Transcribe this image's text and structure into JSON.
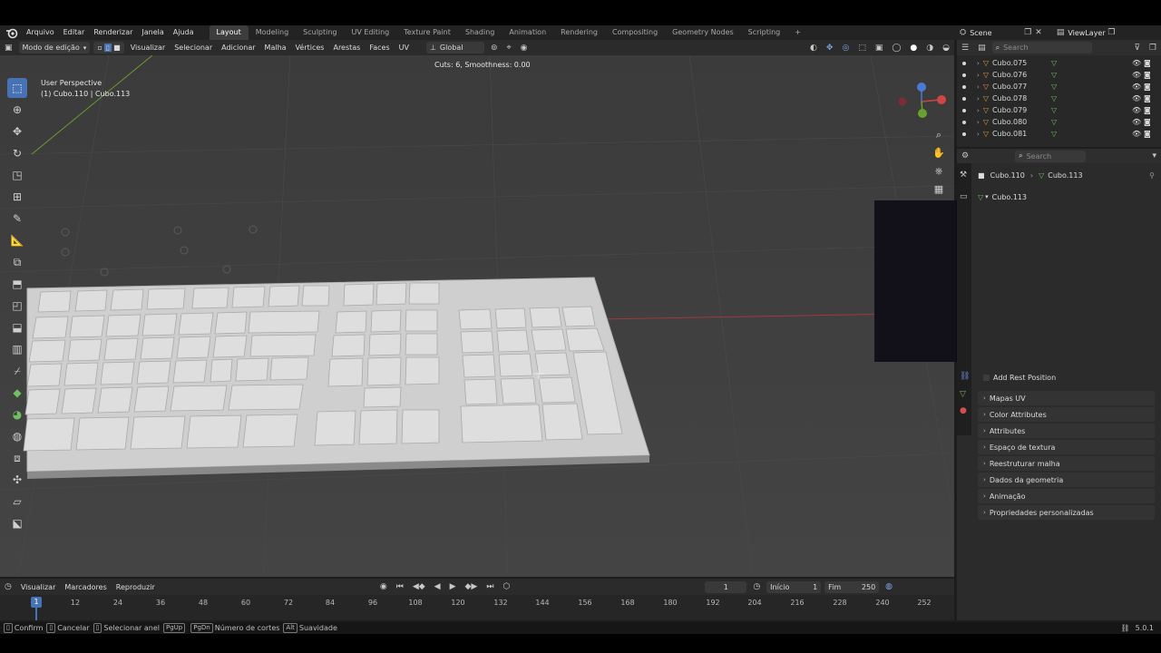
{
  "menu": {
    "items": [
      "Arquivo",
      "Editar",
      "Renderizar",
      "Janela",
      "Ajuda"
    ],
    "workspaces": [
      "Layout",
      "Modeling",
      "Sculpting",
      "UV Editing",
      "Texture Paint",
      "Shading",
      "Animation",
      "Rendering",
      "Compositing",
      "Geometry Nodes",
      "Scripting"
    ],
    "active_workspace": "Layout",
    "add_tab": "+",
    "scene": "Scene",
    "view_layer": "ViewLayer"
  },
  "viewport_header": {
    "mode": "Modo de edição",
    "menus": [
      "Visualizar",
      "Selecionar",
      "Adicionar",
      "Malha",
      "Vértices",
      "Arestas",
      "Faces",
      "UV"
    ],
    "transform_orientation": "Global"
  },
  "viewport": {
    "operator_info": "Cuts: 6, Smoothness: 0.00",
    "perspective": "User Perspective",
    "object_info": "(1) Cubo.110 | Cubo.113"
  },
  "timeline": {
    "menus": [
      "Visualizar",
      "Marcadores",
      "Reproduzir"
    ],
    "current_frame": "1",
    "start_label": "Início",
    "start_value": "1",
    "end_label": "Fim",
    "end_value": "250",
    "ruler_ticks": [
      "12",
      "24",
      "36",
      "48",
      "60",
      "72",
      "84",
      "96",
      "108",
      "120",
      "132",
      "144",
      "156",
      "168",
      "180",
      "192",
      "204",
      "216",
      "228",
      "240",
      "252"
    ],
    "playhead_label": "1"
  },
  "statusbar": {
    "confirm": "Confirm",
    "cancel": "Cancelar",
    "select_ring": "Selecionar anel",
    "pgup": "PgUp",
    "pgdn": "PgDn",
    "cuts": "Número de cortes",
    "alt": "Alt",
    "smoothness": "Suavidade",
    "version": "5.0.1"
  },
  "outliner": {
    "search_placeholder": "Search",
    "items": [
      "Cubo.075",
      "Cubo.076",
      "Cubo.077",
      "Cubo.078",
      "Cubo.079",
      "Cubo.080",
      "Cubo.081"
    ]
  },
  "properties": {
    "search_placeholder": "Search",
    "breadcrumb_object": "Cubo.110",
    "breadcrumb_data": "Cubo.113",
    "mesh_name": "Cubo.113",
    "add_rest_position": "Add Rest Position",
    "sections": [
      "Mapas UV",
      "Color Attributes",
      "Attributes",
      "Espaço de textura",
      "Reestruturar malha",
      "Dados da geometria",
      "Animação",
      "Propriedades personalizadas"
    ]
  },
  "colors": {
    "accent": "#4772b3",
    "viewport_bg": "#3f3f3f",
    "mesh_light": "#d4d4d4",
    "outliner_tri": "#e09b3c",
    "mesh_icon": "#6fc05f"
  }
}
